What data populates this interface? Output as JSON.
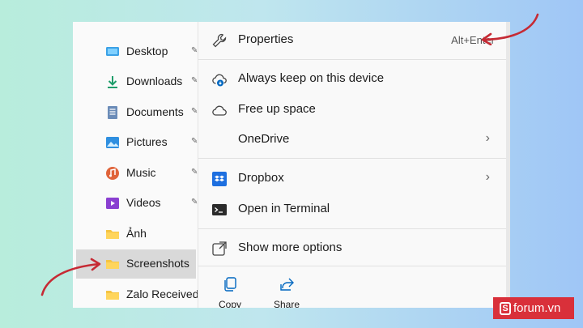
{
  "sidebar": {
    "items": [
      {
        "label": "Desktop",
        "icon": "desktop-icon",
        "pinned": true
      },
      {
        "label": "Downloads",
        "icon": "download-icon",
        "pinned": true
      },
      {
        "label": "Documents",
        "icon": "document-icon",
        "pinned": true
      },
      {
        "label": "Pictures",
        "icon": "picture-icon",
        "pinned": true
      },
      {
        "label": "Music",
        "icon": "music-icon",
        "pinned": true
      },
      {
        "label": "Videos",
        "icon": "video-icon",
        "pinned": true
      },
      {
        "label": "Ảnh",
        "icon": "folder-icon",
        "pinned": false
      },
      {
        "label": "Screenshots",
        "icon": "folder-icon",
        "pinned": false,
        "selected": true
      },
      {
        "label": "Zalo Received",
        "icon": "folder-icon",
        "pinned": false
      }
    ]
  },
  "menu": {
    "items": [
      {
        "label": "Properties",
        "icon": "wrench-icon",
        "shortcut": "Alt+Enter"
      },
      {
        "label": "Always keep on this device",
        "icon": "cloud-download-icon"
      },
      {
        "label": "Free up space",
        "icon": "cloud-icon"
      },
      {
        "label": "OneDrive",
        "submenu": true
      },
      {
        "label": "Dropbox",
        "icon": "dropbox-icon",
        "submenu": true
      },
      {
        "label": "Open in Terminal",
        "icon": "terminal-icon"
      },
      {
        "label": "Show more options",
        "icon": "external-icon"
      }
    ],
    "quick_actions": [
      {
        "label": "Copy",
        "icon": "copy-icon"
      },
      {
        "label": "Share",
        "icon": "share-icon"
      }
    ]
  },
  "watermark": {
    "text": "forum.vn",
    "logo": "s-logo"
  },
  "colors": {
    "accent": "#0067c0",
    "arrow": "#c62a34",
    "badge": "#d9303a"
  }
}
